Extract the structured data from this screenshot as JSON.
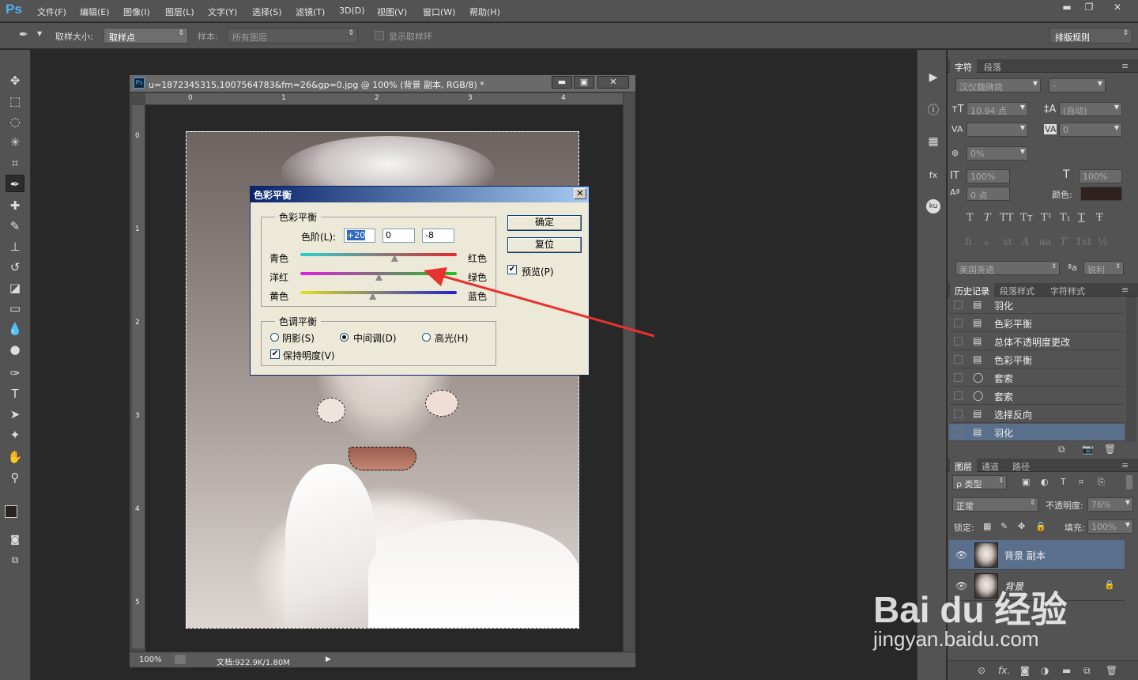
{
  "app": {
    "logo": "Ps"
  },
  "menu": [
    "文件(F)",
    "编辑(E)",
    "图像(I)",
    "图层(L)",
    "文字(Y)",
    "选择(S)",
    "滤镜(T)",
    "3D(D)",
    "视图(V)",
    "窗口(W)",
    "帮助(H)"
  ],
  "window_controls": {
    "min": "▬",
    "restore": "❐",
    "close": "✕"
  },
  "options_bar": {
    "sample_size_label": "取样大小:",
    "sample_size_value": "取样点",
    "sample_label": "样本:",
    "sample_value": "所有图层",
    "show_ring_label": "显示取样环",
    "workspace_value": "排版规则"
  },
  "document": {
    "title": "u=1872345315,1007564783&fm=26&gp=0.jpg @ 100% (背景 副本, RGB/8) *",
    "ruler_top": [
      "0",
      "1",
      "2",
      "3",
      "4"
    ],
    "ruler_left": [
      "0",
      "1",
      "2",
      "3",
      "4",
      "5"
    ],
    "zoom": "100%",
    "doc_info": "文档:922.9K/1.80M"
  },
  "dialog": {
    "title": "色彩平衡",
    "group1_title": "色彩平衡",
    "levels_label": "色阶(L):",
    "levels": [
      "+20",
      "0",
      "-8"
    ],
    "sliders": [
      {
        "left": "青色",
        "right": "红色",
        "value": 20
      },
      {
        "left": "洋红",
        "right": "绿色",
        "value": 0
      },
      {
        "left": "黄色",
        "right": "蓝色",
        "value": -8
      }
    ],
    "group2_title": "色调平衡",
    "tones": [
      "阴影(S)",
      "中间调(D)",
      "高光(H)"
    ],
    "selected_tone": "中间调(D)",
    "preserve_label": "保持明度(V)",
    "preserve_checked": true,
    "ok_label": "确定",
    "reset_label": "复位",
    "preview_label": "预览(P)",
    "preview_checked": true
  },
  "char_panel": {
    "tabs": [
      "字符",
      "段落"
    ],
    "font_family": "汉仪魏碑简",
    "font_style": "-",
    "size": "10.94 点",
    "leading": "(自动)",
    "kerning": "",
    "tracking": "0",
    "scale_pct": "0%",
    "vscale": "100%",
    "hscale": "100%",
    "baseline": "0 点",
    "color_label": "颜色:",
    "type_buttons": [
      "T",
      "T",
      "TT",
      "Tт",
      "T¹",
      "T₁",
      "T",
      "Ŧ"
    ],
    "opentype_buttons": [
      "fi",
      "ℴ",
      "st",
      "A",
      "aa",
      "T",
      "1st",
      "½"
    ],
    "language": "美国英语",
    "aa_label": "ªa",
    "antialias": "锐利"
  },
  "history_panel": {
    "tabs": [
      "历史记录",
      "段落样式",
      "字符样式"
    ],
    "items": [
      {
        "label": "羽化",
        "icon": "doc-icon"
      },
      {
        "label": "色彩平衡",
        "icon": "doc-icon"
      },
      {
        "label": "总体不透明度更改",
        "icon": "doc-icon"
      },
      {
        "label": "色彩平衡",
        "icon": "doc-icon"
      },
      {
        "label": "套索",
        "icon": "lasso-icon"
      },
      {
        "label": "套索",
        "icon": "lasso-icon"
      },
      {
        "label": "选择反向",
        "icon": "doc-icon"
      },
      {
        "label": "羽化",
        "icon": "doc-icon"
      }
    ],
    "selected_index": 7
  },
  "layers_panel": {
    "tabs": [
      "图层",
      "通道",
      "路径"
    ],
    "filter_kind": "ρ 类型",
    "blend_mode": "正常",
    "opacity_label": "不透明度:",
    "opacity": "76%",
    "lock_label": "锁定:",
    "fill_label": "填充:",
    "fill": "100%",
    "layers": [
      {
        "name": "背景 副本",
        "selected": true
      },
      {
        "name": "背景",
        "locked": true
      }
    ]
  },
  "watermark": {
    "logo": "Bai du 经验",
    "url": "jingyan.baidu.com"
  },
  "colors": {
    "accent_arrow": "#e8322d",
    "selection": "#5a6f8c"
  }
}
